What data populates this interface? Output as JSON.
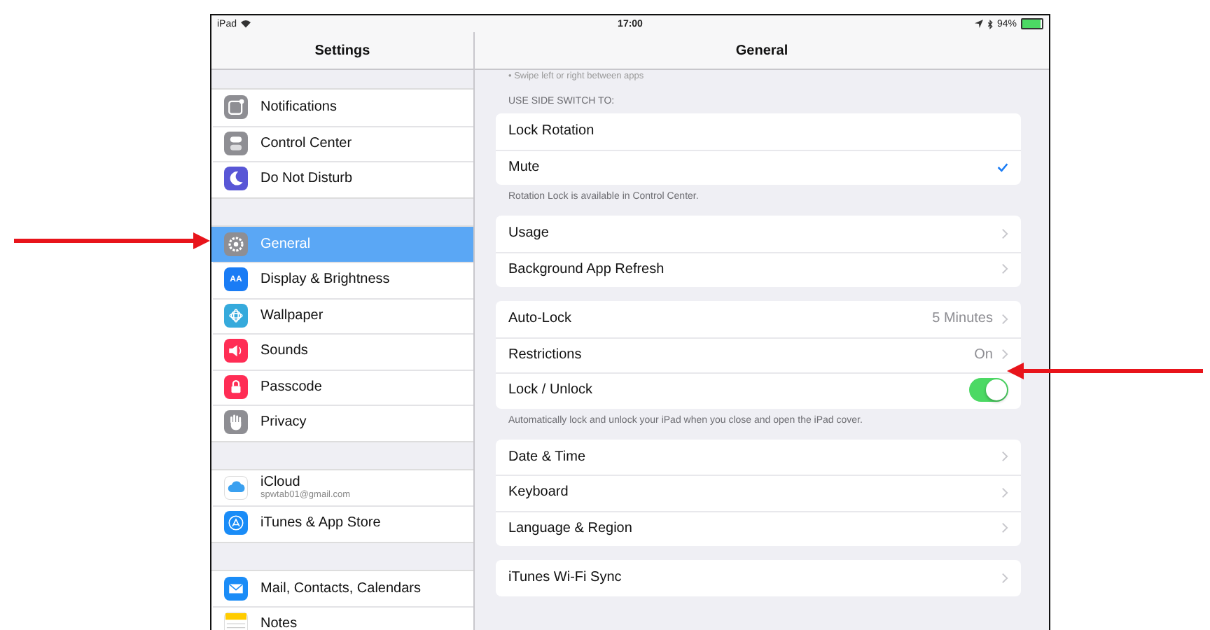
{
  "status_bar": {
    "device": "iPad",
    "time": "17:00",
    "battery": "94%"
  },
  "sidebar": {
    "title": "Settings",
    "groups": [
      {
        "items": [
          {
            "label": "Notifications",
            "kind": "notifications",
            "color": "#8e8e93",
            "selected": false
          },
          {
            "label": "Control Center",
            "kind": "control",
            "color": "#8e8e93",
            "selected": false
          },
          {
            "label": "Do Not Disturb",
            "kind": "moon",
            "color": "#5856d6",
            "selected": false
          }
        ]
      },
      {
        "items": [
          {
            "label": "General",
            "kind": "gear",
            "color": "#8e8e93",
            "selected": true
          },
          {
            "label": "Display & Brightness",
            "kind": "display",
            "icon_text": "AA",
            "color": "#1a7cf5",
            "selected": false
          },
          {
            "label": "Wallpaper",
            "kind": "flower",
            "color": "#35aadc",
            "selected": false
          },
          {
            "label": "Sounds",
            "kind": "speaker",
            "color": "#ff2d55",
            "selected": false
          },
          {
            "label": "Passcode",
            "kind": "lock",
            "color": "#ff2d55",
            "selected": false
          },
          {
            "label": "Privacy",
            "kind": "hand",
            "color": "#8e8e93",
            "selected": false
          }
        ]
      },
      {
        "items": [
          {
            "label": "iCloud",
            "subtitle": "spwtab01@gmail.com",
            "kind": "cloud",
            "color": "#ffffff",
            "selected": false
          },
          {
            "label": "iTunes & App Store",
            "kind": "appstore",
            "color": "#1a8cf7",
            "selected": false
          }
        ]
      },
      {
        "items": [
          {
            "label": "Mail, Contacts, Calendars",
            "kind": "mail",
            "color": "#1a8cf7",
            "selected": false
          },
          {
            "label": "Notes",
            "kind": "notes",
            "color": "#ffffff",
            "selected": false
          }
        ]
      }
    ]
  },
  "detail": {
    "title": "General",
    "top_note": "• Swipe left or right between apps",
    "sections": [
      {
        "header": "USE SIDE SWITCH TO:",
        "rows": [
          {
            "kind": "check",
            "label": "Lock Rotation",
            "checked": false
          },
          {
            "kind": "check",
            "label": "Mute",
            "checked": true
          }
        ],
        "footer": "Rotation Lock is available in Control Center."
      },
      {
        "rows": [
          {
            "kind": "link",
            "label": "Usage"
          },
          {
            "kind": "link",
            "label": "Background App Refresh"
          }
        ]
      },
      {
        "rows": [
          {
            "kind": "link",
            "label": "Auto-Lock",
            "value": "5 Minutes"
          },
          {
            "kind": "link",
            "label": "Restrictions",
            "value": "On"
          },
          {
            "kind": "toggle",
            "label": "Lock / Unlock",
            "on": true
          }
        ],
        "footer": "Automatically lock and unlock your iPad when you close and open the iPad cover."
      },
      {
        "rows": [
          {
            "kind": "link",
            "label": "Date & Time"
          },
          {
            "kind": "link",
            "label": "Keyboard"
          },
          {
            "kind": "link",
            "label": "Language & Region"
          }
        ]
      },
      {
        "rows": [
          {
            "kind": "link",
            "label": "iTunes Wi-Fi Sync"
          }
        ]
      }
    ]
  }
}
